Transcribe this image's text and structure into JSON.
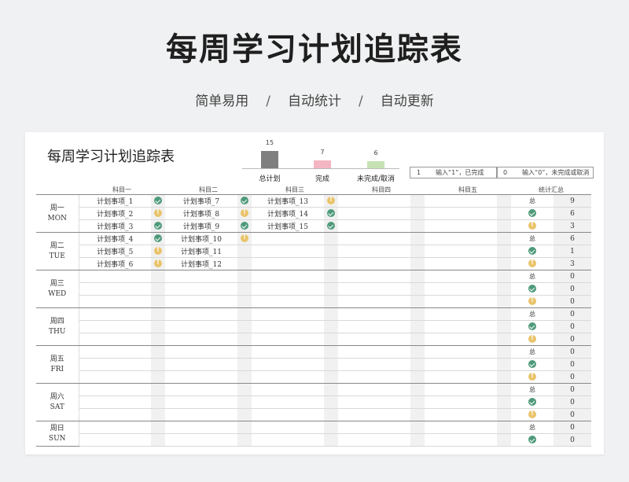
{
  "hero": {
    "title": "每周学习计划追踪表",
    "subtitle_parts": [
      "简单易用",
      "/",
      "自动统计",
      "/",
      "自动更新"
    ]
  },
  "sheet": {
    "title": "每周学习计划追踪表",
    "summary": [
      {
        "label": "总计划",
        "value": 15,
        "color": "#7f7f7f"
      },
      {
        "label": "完成",
        "value": 7,
        "color": "#f4b6c2"
      },
      {
        "label": "未完成/取消",
        "value": 6,
        "color": "#c6e2b3"
      }
    ],
    "legend": [
      {
        "key": "1",
        "text": "输入“1”，已完成"
      },
      {
        "key": "0",
        "text": "输入“0”，未完成或取消"
      }
    ],
    "headers": [
      "科目一",
      "科目二",
      "科目三",
      "科目四",
      "科目五",
      "统计汇总"
    ],
    "icons": {
      "done": "check-circle-icon",
      "pending": "exclamation-circle-icon"
    },
    "stat_labels": [
      "总",
      "done",
      "pending"
    ],
    "days": [
      {
        "cn": "周一",
        "en": "MON",
        "rows": [
          [
            [
              "计划事项_1",
              "ok"
            ],
            [
              "计划事项_7",
              "ok"
            ],
            [
              "计划事项_13",
              "warn"
            ],
            null,
            null
          ],
          [
            [
              "计划事项_2",
              "warn"
            ],
            [
              "计划事项_8",
              "warn"
            ],
            [
              "计划事项_14",
              "ok"
            ],
            null,
            null
          ],
          [
            [
              "计划事项_3",
              "ok"
            ],
            [
              "计划事项_9",
              "ok"
            ],
            [
              "计划事项_15",
              "ok"
            ],
            null,
            null
          ]
        ],
        "stats": [
          "9",
          "6",
          "3"
        ]
      },
      {
        "cn": "周二",
        "en": "TUE",
        "rows": [
          [
            [
              "计划事项_4",
              "ok"
            ],
            [
              "计划事项_10",
              "warn"
            ],
            null,
            null,
            null
          ],
          [
            [
              "计划事项_5",
              "warn"
            ],
            [
              "计划事项_11",
              ""
            ],
            null,
            null,
            null
          ],
          [
            [
              "计划事项_6",
              "warn"
            ],
            [
              "计划事项_12",
              ""
            ],
            null,
            null,
            null
          ]
        ],
        "stats": [
          "6",
          "1",
          "3"
        ]
      },
      {
        "cn": "周三",
        "en": "WED",
        "rows": [
          [
            null,
            null,
            null,
            null,
            null
          ],
          [
            null,
            null,
            null,
            null,
            null
          ],
          [
            null,
            null,
            null,
            null,
            null
          ]
        ],
        "stats": [
          "0",
          "0",
          "0"
        ]
      },
      {
        "cn": "周四",
        "en": "THU",
        "rows": [
          [
            null,
            null,
            null,
            null,
            null
          ],
          [
            null,
            null,
            null,
            null,
            null
          ],
          [
            null,
            null,
            null,
            null,
            null
          ]
        ],
        "stats": [
          "0",
          "0",
          "0"
        ]
      },
      {
        "cn": "周五",
        "en": "FRI",
        "rows": [
          [
            null,
            null,
            null,
            null,
            null
          ],
          [
            null,
            null,
            null,
            null,
            null
          ],
          [
            null,
            null,
            null,
            null,
            null
          ]
        ],
        "stats": [
          "0",
          "0",
          "0"
        ]
      },
      {
        "cn": "周六",
        "en": "SAT",
        "rows": [
          [
            null,
            null,
            null,
            null,
            null
          ],
          [
            null,
            null,
            null,
            null,
            null
          ],
          [
            null,
            null,
            null,
            null,
            null
          ]
        ],
        "stats": [
          "0",
          "0",
          "0"
        ]
      },
      {
        "cn": "周日",
        "en": "SUN",
        "rows": [
          [
            null,
            null,
            null,
            null,
            null
          ],
          [
            null,
            null,
            null,
            null,
            null
          ]
        ],
        "stats": [
          "0",
          "0"
        ]
      }
    ]
  }
}
